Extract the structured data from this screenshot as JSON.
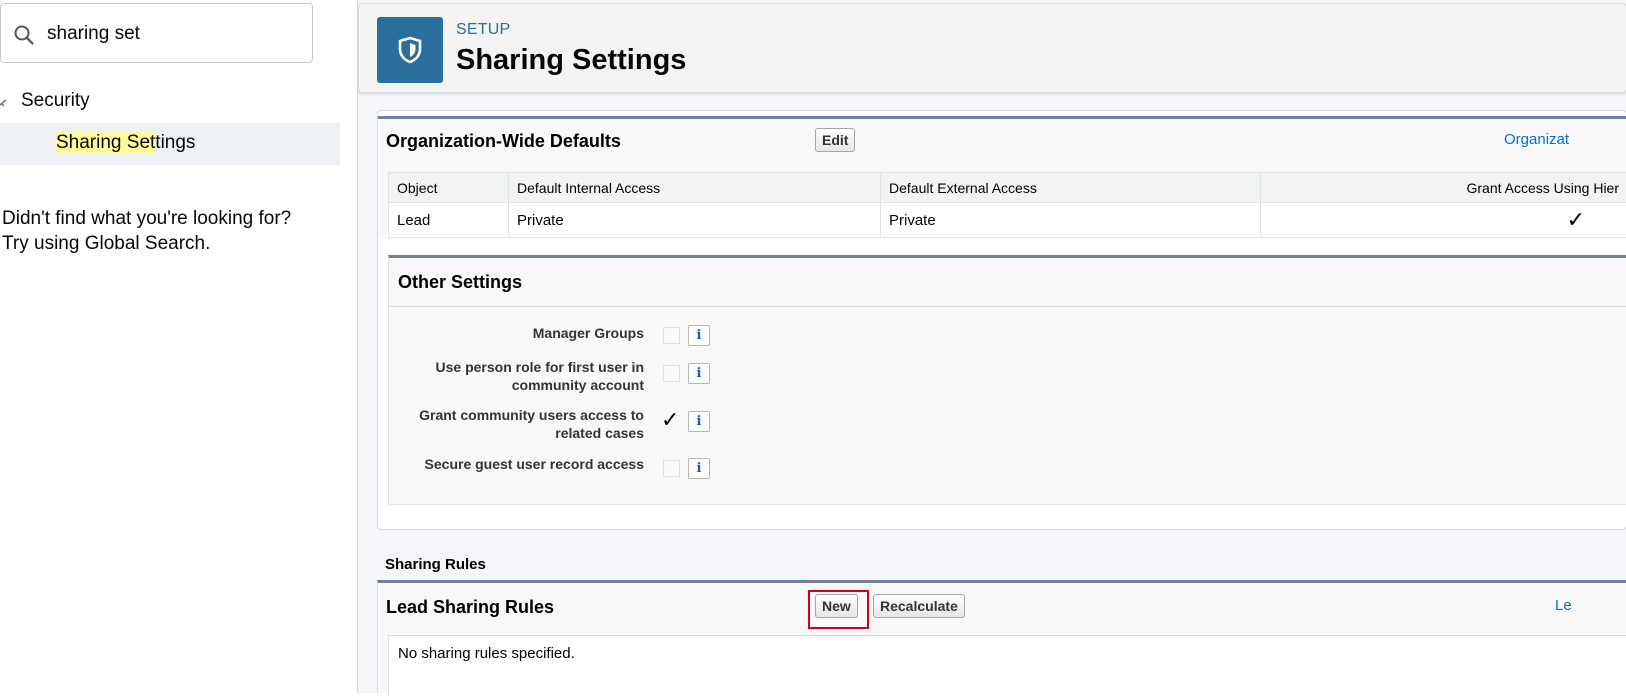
{
  "sidebar": {
    "search": {
      "value": "sharing set",
      "placeholder": ""
    },
    "tree": {
      "parent_label": "Security",
      "child_label_highlight": "Sharing Set",
      "child_label_rest": "tings"
    },
    "not_found_line1": "Didn't find what you're looking for?",
    "not_found_line2": "Try using Global Search."
  },
  "header": {
    "eyebrow": "SETUP",
    "title": "Sharing Settings",
    "icon": "shield-icon"
  },
  "owd": {
    "title": "Organization-Wide Defaults",
    "edit_label": "Edit",
    "help_link": "Organizat",
    "columns": [
      "Object",
      "Default Internal Access",
      "Default External Access",
      "Grant Access Using Hier"
    ],
    "rows": [
      {
        "object": "Lead",
        "internal": "Private",
        "external": "Private",
        "grant_hierarchy": true
      }
    ]
  },
  "other_settings": {
    "title": "Other Settings",
    "items": [
      {
        "label": "Manager Groups",
        "checked": false
      },
      {
        "label": "Use person role for first user in community account",
        "checked": false
      },
      {
        "label": "Grant community users access to related cases",
        "checked": true
      },
      {
        "label": "Secure guest user record access",
        "checked": false
      }
    ],
    "info_glyph": "i"
  },
  "sharing_rules": {
    "section_label": "Sharing Rules",
    "lead": {
      "title": "Lead Sharing Rules",
      "new_label": "New",
      "recalculate_label": "Recalculate",
      "help_link": "Le",
      "empty_text": "No sharing rules specified."
    }
  },
  "colors": {
    "accent": "#2a6e9e",
    "link": "#0070d2",
    "focus": "#d0021b",
    "highlight": "#fffa9c"
  }
}
